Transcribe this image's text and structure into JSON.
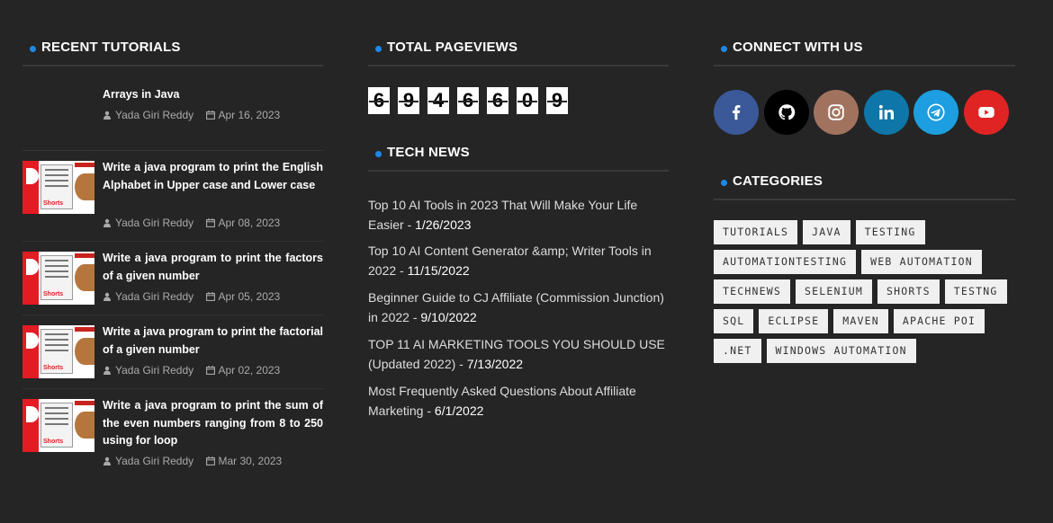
{
  "recent": {
    "title": "RECENT TUTORIALS",
    "posts": [
      {
        "title": "Arrays in Java",
        "author": "Yada Giri Reddy",
        "date": "Apr 16, 2023"
      },
      {
        "title": "Write a java program to print the English Alphabet in Upper case and Lower case",
        "author": "Yada Giri Reddy",
        "date": "Apr 08, 2023"
      },
      {
        "title": "Write a java program to print the factors of a given number",
        "author": "Yada Giri Reddy",
        "date": "Apr 05, 2023"
      },
      {
        "title": "Write a java program to print the factorial of a given number",
        "author": "Yada Giri Reddy",
        "date": "Apr 02, 2023"
      },
      {
        "title": "Write a java program to print the sum of the even numbers ranging from 8 to 250 using for loop",
        "author": "Yada Giri Reddy",
        "date": "Mar 30, 2023"
      }
    ],
    "thumb_text": "Shorts"
  },
  "pageviews": {
    "title": "TOTAL PAGEVIEWS",
    "digits": [
      "6",
      "9",
      "4",
      "6",
      "6",
      "0",
      "9"
    ]
  },
  "technews": {
    "title": "TECH NEWS",
    "items": [
      {
        "text": "Top 10 AI Tools in 2023 That Will Make Your Life Easier",
        "date": "1/26/2023"
      },
      {
        "text": "Top 10 AI Content Generator &amp; Writer Tools in 2022",
        "date": "11/15/2022"
      },
      {
        "text": "Beginner Guide to CJ Affiliate (Commission Junction) in 2022",
        "date": "9/10/2022"
      },
      {
        "text": "TOP 11 AI MARKETING TOOLS YOU SHOULD USE (Updated 2022)",
        "date": "7/13/2022"
      },
      {
        "text": "Most Frequently Asked Questions About Affiliate Marketing",
        "date": "6/1/2022"
      }
    ]
  },
  "connect": {
    "title": "CONNECT WITH US",
    "networks": [
      {
        "name": "facebook",
        "color": "#3b5998"
      },
      {
        "name": "github",
        "color": "#000000"
      },
      {
        "name": "instagram",
        "color": "#a1735f"
      },
      {
        "name": "linkedin",
        "color": "#0e76a8"
      },
      {
        "name": "telegram",
        "color": "#1d9ee0"
      },
      {
        "name": "youtube",
        "color": "#e02424"
      }
    ]
  },
  "categories": {
    "title": "CATEGORIES",
    "tags": [
      "TUTORIALS",
      "JAVA",
      "TESTING",
      "AUTOMATIONTESTING",
      "WEB AUTOMATION",
      "TECHNEWS",
      "SELENIUM",
      "SHORTS",
      "TESTNG",
      "SQL",
      "ECLIPSE",
      "MAVEN",
      "APACHE POI",
      ".NET",
      "WINDOWS AUTOMATION"
    ]
  },
  "colors": {
    "accent": "#1e88e5",
    "background": "#252525"
  }
}
